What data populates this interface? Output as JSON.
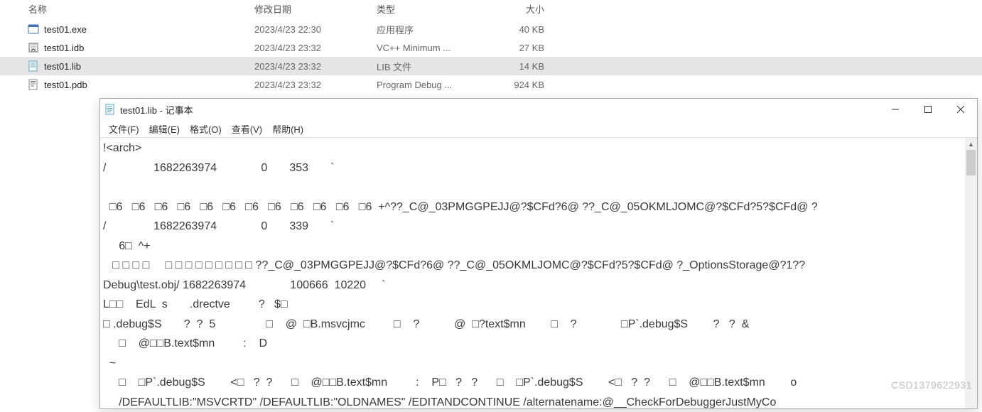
{
  "explorer": {
    "columns": {
      "name": "名称",
      "date": "修改日期",
      "type": "类型",
      "size": "大小"
    },
    "rows": [
      {
        "icon": "exe",
        "name": "test01.exe",
        "date": "2023/4/23 22:30",
        "type": "应用程序",
        "size": "40 KB",
        "selected": false
      },
      {
        "icon": "idb",
        "name": "test01.idb",
        "date": "2023/4/23 23:32",
        "type": "VC++ Minimum ...",
        "size": "27 KB",
        "selected": false
      },
      {
        "icon": "lib",
        "name": "test01.lib",
        "date": "2023/4/23 23:32",
        "type": "LIB 文件",
        "size": "14 KB",
        "selected": true
      },
      {
        "icon": "pdb",
        "name": "test01.pdb",
        "date": "2023/4/23 23:32",
        "type": "Program Debug ...",
        "size": "924 KB",
        "selected": false
      }
    ]
  },
  "notepad": {
    "title": "test01.lib - 记事本",
    "menus": {
      "file": "文件(F)",
      "edit": "编辑(E)",
      "format": "格式(O)",
      "view": "查看(V)",
      "help": "帮助(H)"
    },
    "content": "!<arch>\n/               1682263974              0       353       `\n\n  □6   □6   □6   □6   □6   □6   □6   □6   □6   □6   □6   □6  +^??_C@_03PMGGPEJJ@?$CFd?6@ ??_C@_05OKMLJOMC@?$CFd?5?$CFd@ ?\n/               1682263974              0       339       `\n     6□  ^+\n   □ □ □ □     □ □ □ □ □ □ □ □ □ ??_C@_03PMGGPEJJ@?$CFd?6@ ??_C@_05OKMLJOMC@?$CFd?5?$CFd@ ?_OptionsStorage@?1??\nDebug\\test.obj/ 1682263974              100666  10220     `\nL□□    EdL  s       .drectve         ?   $□\n□ .debug$S       ?  ?  5                □    @  □B.msvcjmc         □    ?           @  □?text$mn        □    ?              □P`.debug$S        ?   ?  &\n     □    @□□B.text$mn         :    D\n  ~\n     □    □P`.debug$S        <□   ?  ?      □    @□□B.text$mn         :    P□   ?   ?      □    □P`.debug$S        <□   ?  ?      □    @□□B.text$mn        o\n     /DEFAULTLIB:\"MSVCRTD\" /DEFAULTLIB:\"OLDNAMES\" /EDITANDCONTINUE /alternatename:@__CheckForDebuggerJustMyCo"
  },
  "watermark": "CSD1379622931"
}
